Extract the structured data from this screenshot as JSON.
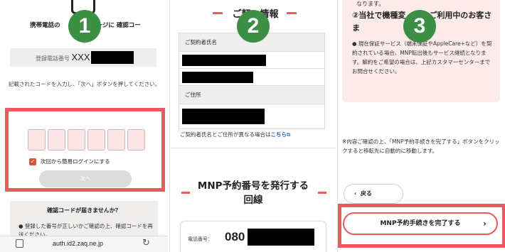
{
  "steps": {
    "one": "1",
    "two": "2",
    "three": "3"
  },
  "panel1": {
    "message": "携帯電話の　　　　ッセージに 確認コー　　　しました",
    "phone_label": "登録電話番号",
    "phone_prefix": "XXX",
    "instruction": "記載されたコードを入力し、「次へ」ボタンを押してください。",
    "checkbox_label": "次回から簡易ログインにする",
    "next_button": "次へ",
    "help_title": "確認コードが届きませんか？",
    "help_text": "● 登録した番号が正しいかご確認の上、確認コードを再送ください。",
    "url": "auth.id2.zaq.ne.jp"
  },
  "panel2": {
    "section_title": "ご契　情報",
    "contractor_label": "ご契約者氏名",
    "address_label": "ご住所",
    "note_text": "ご契約者氏名とご住所が異なる場合は",
    "note_link": "こちら",
    "mnp_title_line1": "MNP予約番号を発行する",
    "mnp_title_line2": "回線",
    "number_label": "電話番号：",
    "number_prefix": "080"
  },
  "panel3": {
    "top_text": "なります。",
    "title": "②当社で機種変　　　ご利用中のお客さま",
    "body": "● 現在保証サービス（端末保証やAppleCare+など）を契約されている場合、MNP転出後もサービス継続となります。解約をご希望の場合は、上記カスタマーセンターまでお問合せください。",
    "note": "※内容ご確認の上、「MNP予約手続きを完了する」ボタンをクリックすると移転先に自動的に移動します。",
    "back_button": "戻る",
    "complete_button": "MNP予約手続きを完了する"
  },
  "colors": {
    "accent_red": "#ea5a5f",
    "step_green": "#3d8f45",
    "link_blue": "#1a63c9"
  }
}
